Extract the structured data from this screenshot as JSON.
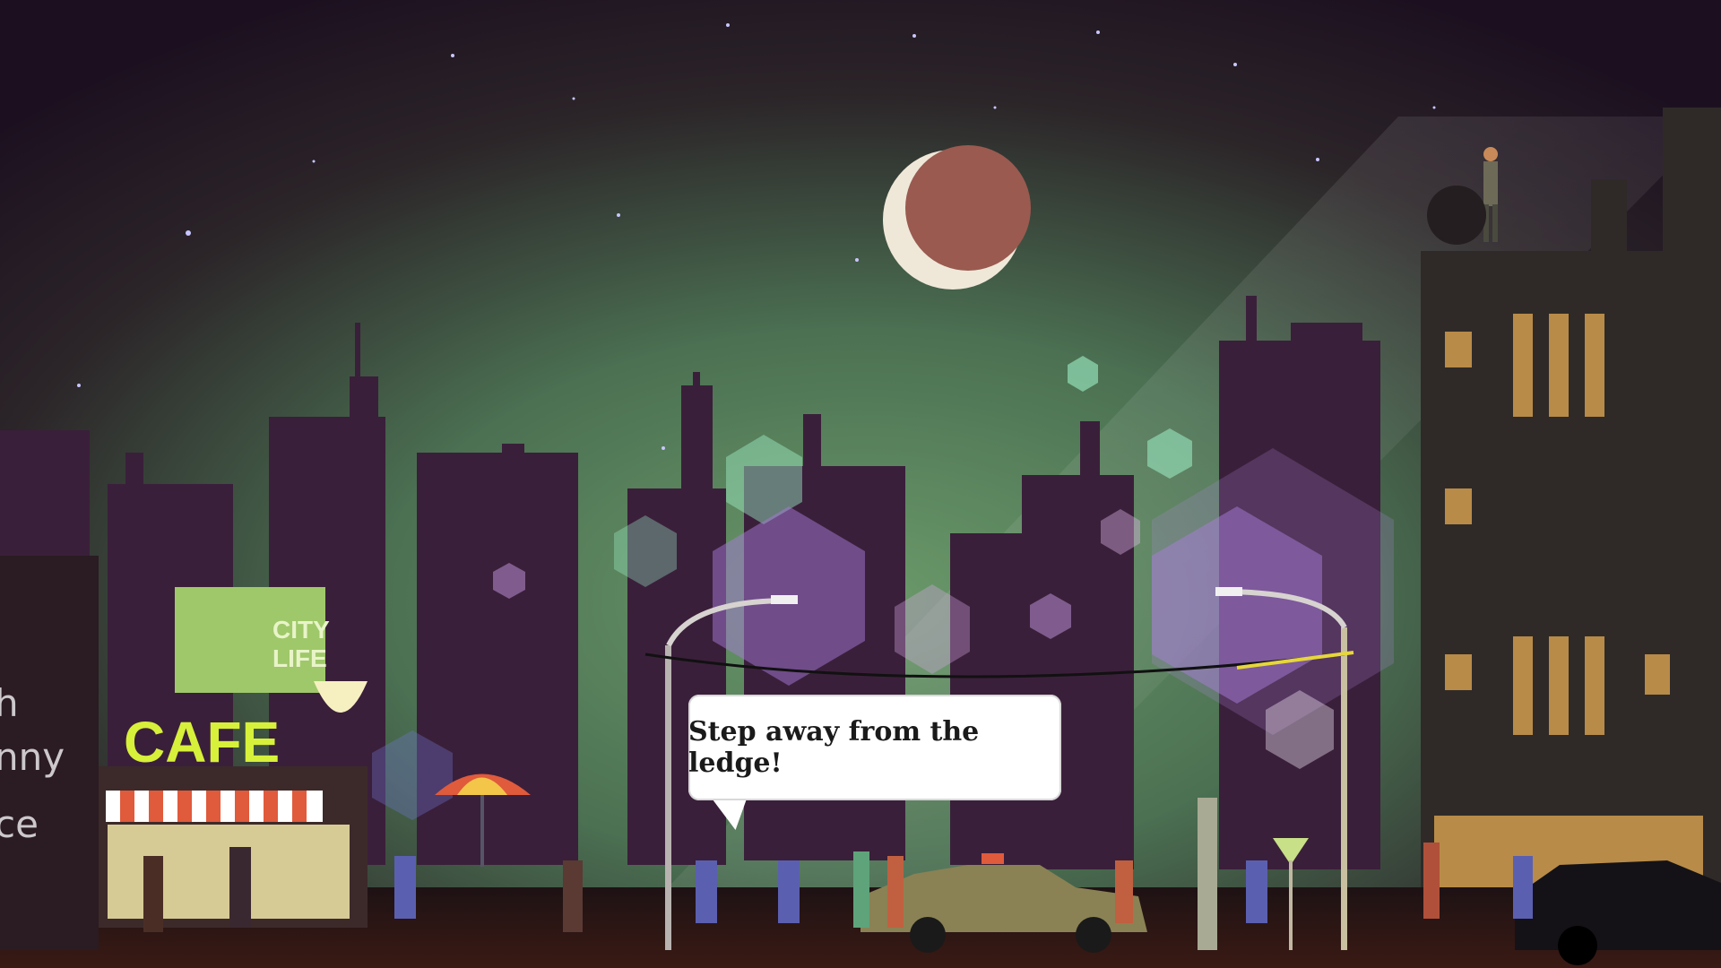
{
  "dialogue": {
    "text": "Step away from the ledge!"
  },
  "signage": {
    "billboard": "CITY\nLIFE",
    "cafe": "CAFE",
    "edge_lines": [
      "h",
      "nny",
      "ce"
    ]
  },
  "palette": {
    "sky_top": "#1e1220",
    "sky_glow": "#5e8a5e",
    "moon": "#9a5a50",
    "moon_crescent": "#efe8d8",
    "skyline": "#3a1f3a",
    "street": "#2a1616",
    "neon_yellow": "#d7f03a",
    "bokeh_purple": "#a67ad8",
    "bokeh_green": "#9ff0c8",
    "police_blue": "#5b5fb0",
    "taxi": "#8a8254"
  }
}
